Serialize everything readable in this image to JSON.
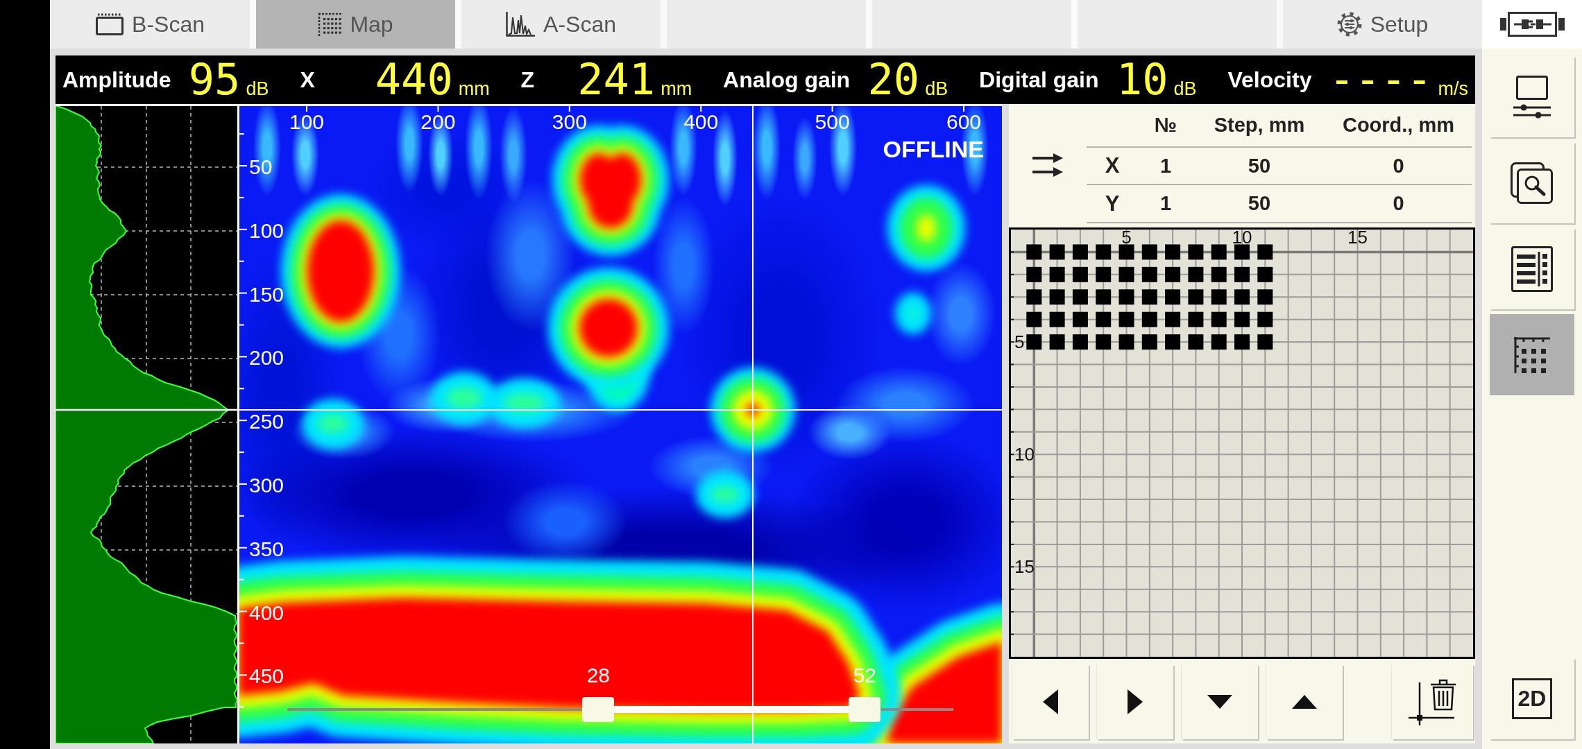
{
  "tabs": [
    {
      "kind": "b-scan",
      "label": "B-Scan",
      "selected": false
    },
    {
      "kind": "map",
      "label": "Map",
      "selected": true
    },
    {
      "kind": "a-scan",
      "label": "A-Scan",
      "selected": false
    },
    {
      "kind": "blank",
      "selected": false
    },
    {
      "kind": "blank",
      "selected": false
    },
    {
      "kind": "blank",
      "selected": false
    },
    {
      "kind": "setup",
      "label": "Setup",
      "selected": false
    }
  ],
  "readouts": [
    {
      "label": "Amplitude",
      "value": "95",
      "unit": "dB"
    },
    {
      "label": "X",
      "value": "440",
      "unit": "mm"
    },
    {
      "label": "Z",
      "value": "241",
      "unit": "mm"
    },
    {
      "label": "Analog gain",
      "value": "20",
      "unit": "dB"
    },
    {
      "label": "Digital gain",
      "value": "10",
      "unit": "dB"
    },
    {
      "label": "Velocity",
      "value": "----",
      "unit": "m/s"
    }
  ],
  "map": {
    "status": "OFFLINE",
    "x_ticks": [
      "100",
      "200",
      "300",
      "400",
      "500",
      "600"
    ],
    "y_ticks": [
      "50",
      "100",
      "150",
      "200",
      "250",
      "300",
      "350",
      "400",
      "450"
    ],
    "range_slider": {
      "low": {
        "label": "28",
        "level": 0.467
      },
      "high": {
        "label": "52",
        "level": 0.867
      }
    }
  },
  "scan_table": {
    "columns": [
      "№",
      "Step, mm",
      "Coord., mm"
    ],
    "rows": [
      {
        "axis": "X",
        "cells": [
          "1",
          "50",
          "0"
        ]
      },
      {
        "axis": "Y",
        "cells": [
          "1",
          "50",
          "0"
        ]
      }
    ]
  },
  "scan_grid": {
    "x_labels": [
      "5",
      "10",
      "15"
    ],
    "y_labels": [
      "5",
      "10",
      "15"
    ],
    "points": [
      [
        true,
        true,
        true,
        true,
        true,
        true,
        true,
        true,
        true,
        true,
        true
      ],
      [
        true,
        true,
        true,
        true,
        true,
        true,
        true,
        true,
        true,
        true,
        true
      ],
      [
        true,
        true,
        true,
        true,
        true,
        true,
        true,
        true,
        true,
        true,
        true
      ],
      [
        true,
        true,
        true,
        true,
        true,
        true,
        true,
        true,
        true,
        true,
        true
      ],
      [
        true,
        true,
        true,
        true,
        true,
        true,
        true,
        true,
        true,
        true,
        true
      ]
    ]
  },
  "grid_buttons": [
    {
      "kind": "left"
    },
    {
      "kind": "right"
    },
    {
      "kind": "down"
    },
    {
      "kind": "up"
    },
    {
      "kind": "clear"
    }
  ],
  "sidebar": {
    "buttons": [
      {
        "kind": "display-settings",
        "selected": false
      },
      {
        "kind": "search",
        "selected": false
      },
      {
        "kind": "list",
        "selected": false
      },
      {
        "kind": "map",
        "selected": true
      }
    ],
    "mode_button": "2D"
  }
}
